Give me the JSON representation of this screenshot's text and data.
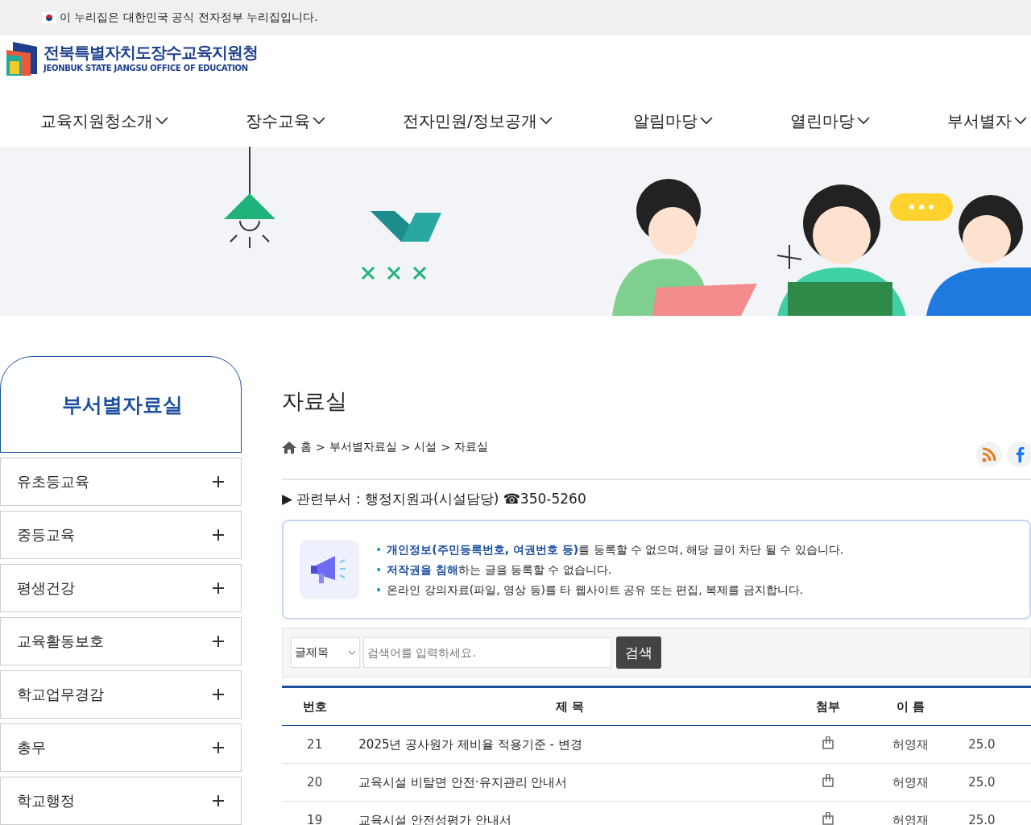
{
  "gov_banner": {
    "text": "이 누리집은 대한민국 공식 전자정부 누리집입니다."
  },
  "logo": {
    "name": "전북특별자치도장수교육지원청",
    "subtitle": "JEONBUK STATE JANGSU OFFICE OF EDUCATION"
  },
  "nav": [
    {
      "label": "교육지원청소개"
    },
    {
      "label": "장수교육"
    },
    {
      "label": "전자민원/정보공개"
    },
    {
      "label": "알림마당"
    },
    {
      "label": "열린마당"
    },
    {
      "label": "부서별자"
    }
  ],
  "sidebar": {
    "title": "부서별자료실",
    "items": [
      {
        "label": "유초등교육"
      },
      {
        "label": "중등교육"
      },
      {
        "label": "평생건강"
      },
      {
        "label": "교육활동보호"
      },
      {
        "label": "학교업무경감"
      },
      {
        "label": "총무"
      },
      {
        "label": "학교행정"
      }
    ]
  },
  "page_title": "자료실",
  "breadcrumb": {
    "separator": ">",
    "items": [
      "홈",
      "부서별자료실",
      "시설",
      "자료실"
    ]
  },
  "department": "▶ 관련부서 : 행정지원과(시설담당) ☎350-5260",
  "notice_bullet": "•",
  "notices": [
    "**개인정보(주민등록번호, 여권번호 등)**를 등록할 수 없으며, 해당 글이 차단 될 수 있습니다.",
    "**저작권을 침해**하는 글을 등록할 수 없습니다.",
    "온라인 강의자료(파일, 영상 등)를 타 웹사이트 공유 또는 편집, 복제를 금지합니다."
  ],
  "search": {
    "scope": "글제목",
    "placeholder": "검색어를 입력하세요.",
    "button": "검색"
  },
  "table": {
    "columns": [
      "번호",
      "제 목",
      "첨부",
      "이 름"
    ],
    "rows": [
      {
        "no": "21",
        "title": "2025년 공사원가 제비율 적용기준 - 변경",
        "attachment": true,
        "name": "허영재",
        "date": "25.0"
      },
      {
        "no": "20",
        "title": "교육시설 비탈면 안전·유지관리 안내서",
        "attachment": true,
        "name": "허영재",
        "date": "25.0"
      },
      {
        "no": "19",
        "title": "교육시설 안전성평가 안내서",
        "attachment": true,
        "name": "허영재",
        "date": "25.0"
      }
    ]
  }
}
